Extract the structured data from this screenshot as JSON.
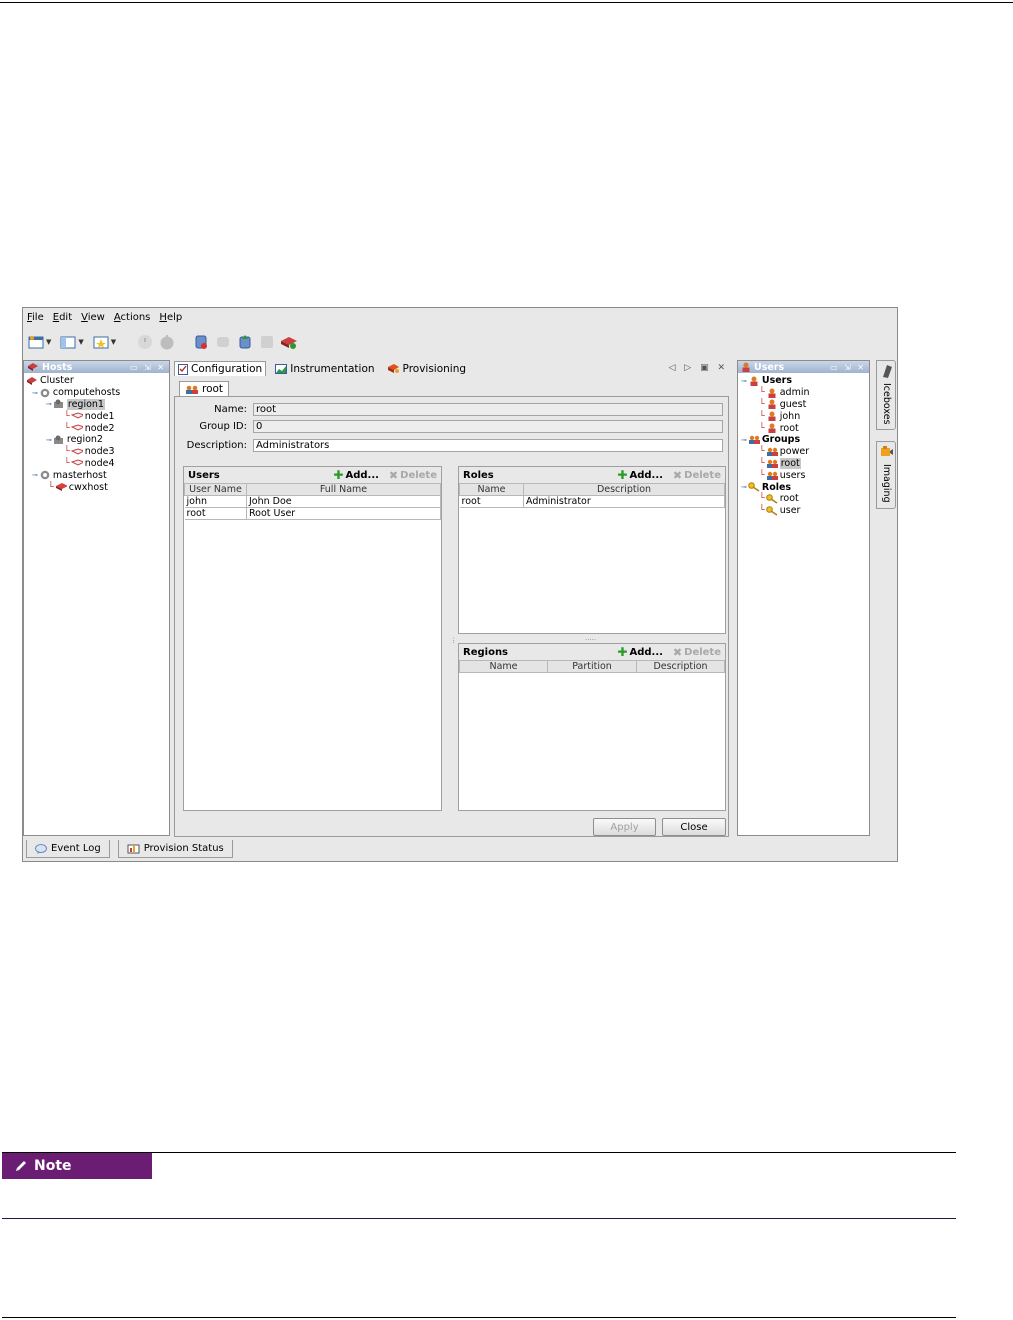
{
  "menu": {
    "items": [
      {
        "label": "File",
        "u": "F",
        "rest": "ile"
      },
      {
        "label": "Edit",
        "u": "E",
        "rest": "dit"
      },
      {
        "label": "View",
        "u": "V",
        "rest": "iew"
      },
      {
        "label": "Actions",
        "u": "A",
        "rest": "ctions"
      },
      {
        "label": "Help",
        "u": "H",
        "rest": "elp"
      }
    ]
  },
  "hosts_panel": {
    "title": "Hosts",
    "tree": [
      {
        "label": "Cluster",
        "level": 0,
        "icon": "cluster-icon"
      },
      {
        "label": "computehosts",
        "level": 1,
        "icon": "globe-icon"
      },
      {
        "label": "region1",
        "level": 2,
        "icon": "region-icon",
        "selected": true
      },
      {
        "label": "node1",
        "level": 3,
        "icon": "node-icon"
      },
      {
        "label": "node2",
        "level": 3,
        "icon": "node-icon"
      },
      {
        "label": "region2",
        "level": 2,
        "icon": "region-icon"
      },
      {
        "label": "node3",
        "level": 3,
        "icon": "node-icon"
      },
      {
        "label": "node4",
        "level": 3,
        "icon": "node-icon"
      },
      {
        "label": "masterhost",
        "level": 1,
        "icon": "globe-icon"
      },
      {
        "label": "cwxhost",
        "level": 2,
        "icon": "host-icon"
      }
    ]
  },
  "center": {
    "tabs": {
      "configuration": "Configuration",
      "instrumentation": "Instrumentation",
      "provisioning": "Provisioning"
    },
    "subtab": "root",
    "form": {
      "name_label": "Name:",
      "name_value": "root",
      "group_id_label": "Group ID:",
      "group_id_value": "0",
      "description_label": "Description:",
      "description_value": "Administrators"
    },
    "users": {
      "title": "Users",
      "add": "Add...",
      "delete": "Delete",
      "columns": [
        "User Name",
        "Full Name"
      ],
      "rows": [
        [
          "john",
          "John Doe"
        ],
        [
          "root",
          "Root User"
        ]
      ]
    },
    "roles": {
      "title": "Roles",
      "add": "Add...",
      "delete": "Delete",
      "columns": [
        "Name",
        "Description"
      ],
      "rows": [
        [
          "root",
          "Administrator"
        ]
      ]
    },
    "regions": {
      "title": "Regions",
      "add": "Add...",
      "delete": "Delete",
      "columns": [
        "Name",
        "Partition",
        "Description"
      ],
      "rows": []
    },
    "apply": "Apply",
    "close": "Close"
  },
  "users_panel": {
    "title": "Users",
    "tree": [
      {
        "label": "Users",
        "level": 0,
        "icon": "user-group-icon",
        "bold": true
      },
      {
        "label": "admin",
        "level": 1,
        "icon": "user-icon"
      },
      {
        "label": "guest",
        "level": 1,
        "icon": "user-icon"
      },
      {
        "label": "john",
        "level": 1,
        "icon": "user-icon"
      },
      {
        "label": "root",
        "level": 1,
        "icon": "user-icon"
      },
      {
        "label": "Groups",
        "level": 0,
        "icon": "group-icon",
        "bold": true
      },
      {
        "label": "power",
        "level": 1,
        "icon": "group-icon"
      },
      {
        "label": "root",
        "level": 1,
        "icon": "group-icon",
        "selected": true
      },
      {
        "label": "users",
        "level": 1,
        "icon": "group-icon"
      },
      {
        "label": "Roles",
        "level": 0,
        "icon": "key-icon",
        "bold": true
      },
      {
        "label": "root",
        "level": 1,
        "icon": "key-icon"
      },
      {
        "label": "user",
        "level": 1,
        "icon": "key-icon"
      }
    ]
  },
  "side_tabs": [
    "Iceboxes",
    "Imaging"
  ],
  "bottom_tabs": [
    "Event Log",
    "Provision Status"
  ],
  "note": {
    "label": "Note"
  },
  "colors": {
    "note_bg": "#6a1d72",
    "title_gradient_top": "#c9d6e8",
    "title_gradient_bottom": "#9fb3cf"
  }
}
